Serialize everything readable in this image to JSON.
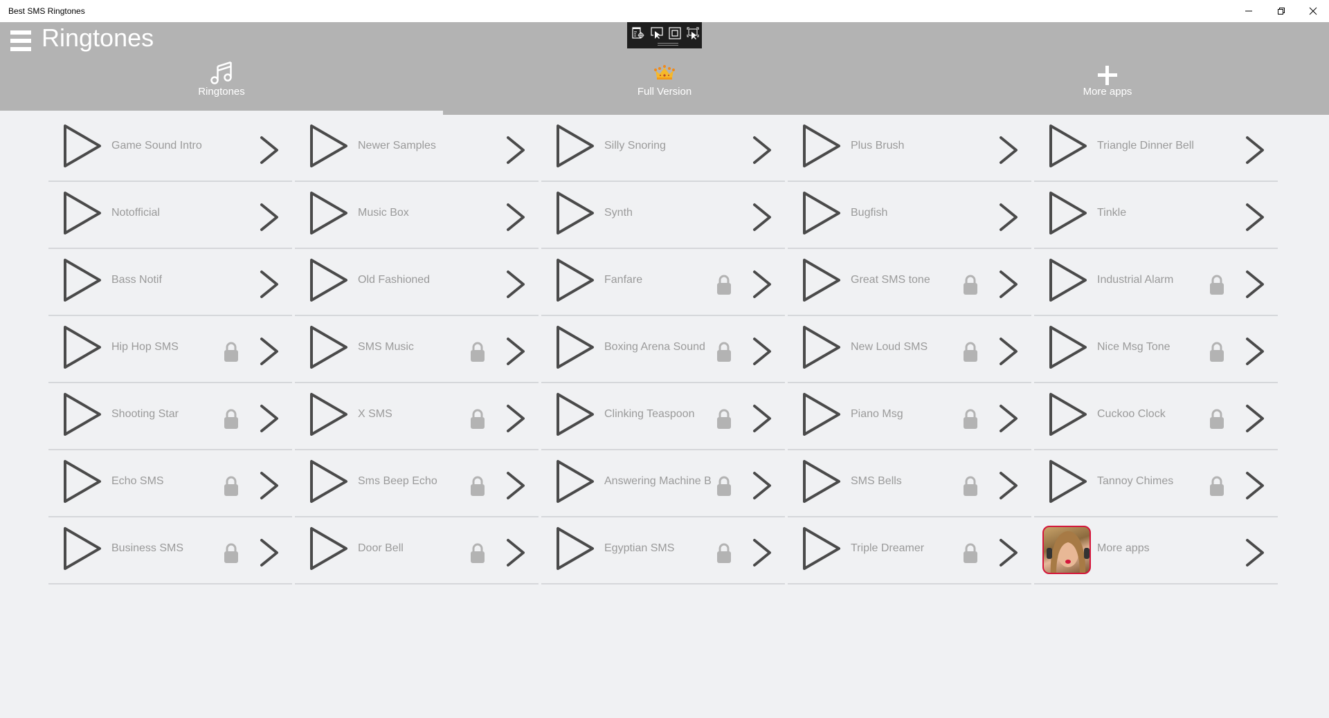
{
  "window": {
    "title": "Best SMS Ringtones",
    "controls": [
      "minimize-icon",
      "restore-icon",
      "close-icon"
    ]
  },
  "header": {
    "menu_icon": "hamburger-icon",
    "title": "Ringtones",
    "tabs": [
      {
        "label": "Ringtones",
        "icon": "music-note-icon",
        "selected": true
      },
      {
        "label": "Full Version",
        "icon": "crown-icon",
        "selected": false
      },
      {
        "label": "More apps",
        "icon": "plus-icon",
        "selected": false
      }
    ]
  },
  "overlay_toolbar": {
    "icons": [
      "inspect-icon",
      "select-element-icon",
      "frame-icon",
      "screen-select-icon"
    ]
  },
  "colors": {
    "header_bg": "#b3b3b3",
    "content_bg": "#f0f1f3",
    "text_muted": "#9a9a9a",
    "icon_dark": "#4a4a4a",
    "lock": "#b3b3b3",
    "thumb_border": "#d4153a"
  },
  "ringtones": [
    [
      {
        "name": "Game Sound Intro",
        "locked": false
      },
      {
        "name": "Newer Samples",
        "locked": false
      },
      {
        "name": "Silly Snoring",
        "locked": false
      },
      {
        "name": "Plus Brush",
        "locked": false
      },
      {
        "name": "Triangle Dinner Bell",
        "locked": false
      }
    ],
    [
      {
        "name": "Notofficial",
        "locked": false
      },
      {
        "name": "Music Box",
        "locked": false
      },
      {
        "name": "Synth",
        "locked": false
      },
      {
        "name": "Bugfish",
        "locked": false
      },
      {
        "name": "Tinkle",
        "locked": false
      }
    ],
    [
      {
        "name": "Bass Notif",
        "locked": false
      },
      {
        "name": "Old Fashioned",
        "locked": false
      },
      {
        "name": "Fanfare",
        "locked": true
      },
      {
        "name": "Great SMS tone",
        "locked": true
      },
      {
        "name": "Industrial Alarm",
        "locked": true
      }
    ],
    [
      {
        "name": "Hip Hop SMS",
        "locked": true
      },
      {
        "name": "SMS Music",
        "locked": true
      },
      {
        "name": "Boxing Arena Sound",
        "locked": true
      },
      {
        "name": "New Loud SMS",
        "locked": true
      },
      {
        "name": "Nice Msg Tone",
        "locked": true
      }
    ],
    [
      {
        "name": "Shooting Star",
        "locked": true
      },
      {
        "name": "X SMS",
        "locked": true
      },
      {
        "name": "Clinking Teaspoon",
        "locked": true
      },
      {
        "name": "Piano Msg",
        "locked": true
      },
      {
        "name": "Cuckoo Clock",
        "locked": true
      }
    ],
    [
      {
        "name": "Echo SMS",
        "locked": true
      },
      {
        "name": "Sms Beep Echo",
        "locked": true
      },
      {
        "name": "Answering Machine B",
        "locked": true
      },
      {
        "name": "SMS Bells",
        "locked": true
      },
      {
        "name": "Tannoy Chimes",
        "locked": true
      }
    ],
    [
      {
        "name": "Business SMS",
        "locked": true
      },
      {
        "name": "Door Bell",
        "locked": true
      },
      {
        "name": "Egyptian SMS",
        "locked": true
      },
      {
        "name": "Triple Dreamer",
        "locked": true
      },
      {
        "name": "More apps",
        "locked": false,
        "is_promo": true
      }
    ]
  ]
}
